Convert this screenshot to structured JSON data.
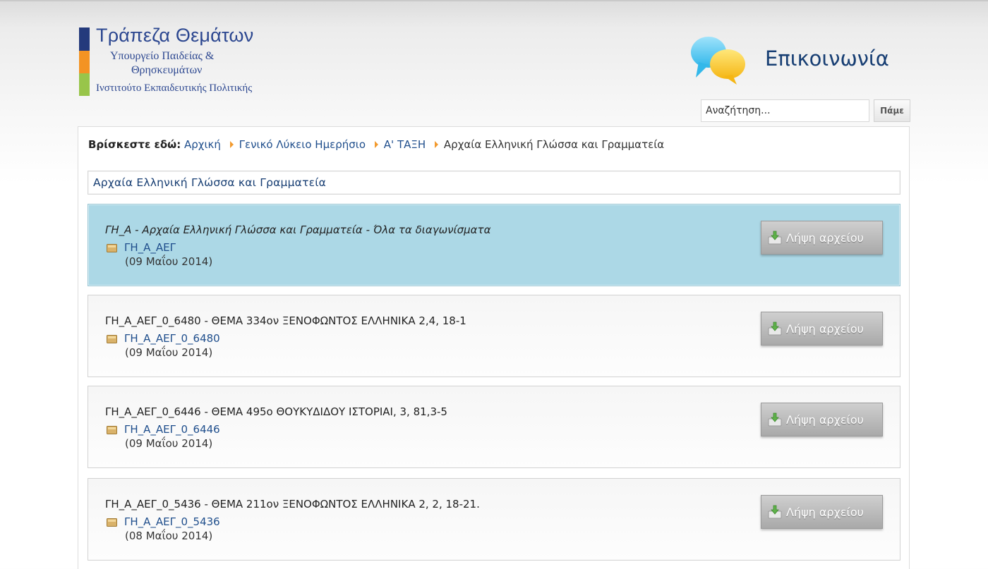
{
  "logo": {
    "title": "Τράπεζα Θεμάτων",
    "line2": "Υπουργείο Παιδείας &",
    "line3": "Θρησκευμάτων",
    "line4": "Ινστιτούτο Εκπαιδευτικής Πολιτικής",
    "colors": [
      "#243a7c",
      "#f39323",
      "#98c54a"
    ]
  },
  "contact": {
    "label": "Επικοινωνία",
    "icon": "speech-bubbles-icon"
  },
  "search": {
    "placeholder": "Αναζήτηση...",
    "button_label": "Πάμε"
  },
  "breadcrumb": {
    "lead": "Βρίσκεστε εδώ:",
    "items": [
      "Αρχική",
      "Γενικό Λύκειο Ημερήσιο",
      "Α' ΤΑΞΗ",
      "Αρχαία Ελληνική Γλώσσα και Γραμματεία"
    ]
  },
  "category_title": "Αρχαία Ελληνική Γλώσσα και Γραμματεία",
  "download_label": "Λήψη αρχείου",
  "items": [
    {
      "title": "ΓΗ_Α - Αρχαία Ελληνική Γλώσσα και Γραμματεία - Όλα τα διαγωνίσματα",
      "file": "ΓΗ_Α_ΑΕΓ",
      "date": "(09 Μαΐου 2014)"
    },
    {
      "title": "ΓΗ_Α_ΑΕΓ_0_6480 - ΘΕΜΑ 334ον ΞΕΝΟΦΩΝΤΟΣ ΕΛΛΗΝΙΚΑ 2,4, 18-1",
      "file": "ΓΗ_Α_ΑΕΓ_0_6480",
      "date": "(09 Μαΐου 2014)"
    },
    {
      "title": "ΓΗ_Α_ΑΕΓ_0_6446 - ΘΕΜΑ 495ο ΘΟΥΚΥΔΙΔΟΥ ΙΣΤΟΡΙΑΙ, 3, 81,3-5",
      "file": "ΓΗ_Α_ΑΕΓ_0_6446",
      "date": "(09 Μαΐου 2014)"
    },
    {
      "title": "ΓΗ_Α_ΑΕΓ_0_5436 - ΘΕΜΑ 211ον ΞΕΝΟΦΩΝΤΟΣ ΕΛΛΗΝΙΚΑ 2, 2, 18-21.",
      "file": "ΓΗ_Α_ΑΕΓ_0_5436",
      "date": "(08 Μαΐου 2014)"
    }
  ],
  "colors": {
    "highlight": "#acd8e6",
    "link": "#1f4e8c",
    "title_blue": "#173e73",
    "arrow": "#f29a2e"
  }
}
